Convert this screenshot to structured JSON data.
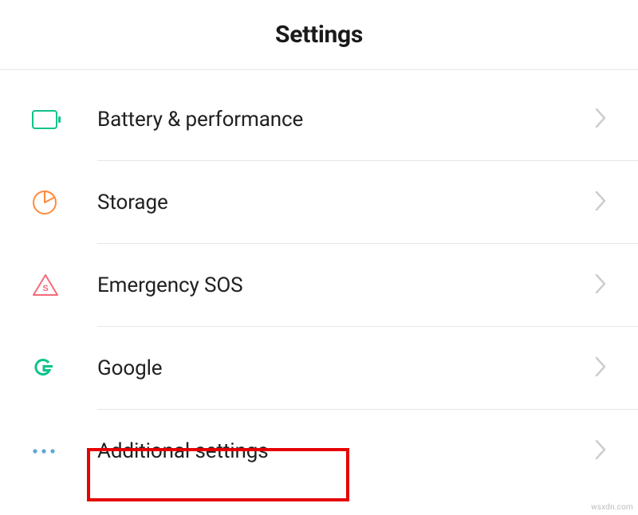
{
  "header": {
    "title": "Settings"
  },
  "rows": [
    {
      "icon": "battery-icon",
      "label": "Battery & performance"
    },
    {
      "icon": "storage-icon",
      "label": "Storage"
    },
    {
      "icon": "emergency-icon",
      "label": "Emergency SOS"
    },
    {
      "icon": "google-icon",
      "label": "Google"
    },
    {
      "icon": "more-icon",
      "label": "Additional settings"
    }
  ],
  "colors": {
    "battery": "#0cc28b",
    "storage": "#ff8a3c",
    "emergency": "#f66a7a",
    "google": "#0cc28b",
    "more": "#5aa8d6",
    "chevron": "#cdcdcd",
    "highlight": "#e60000"
  },
  "watermark": "wsxdn.com"
}
